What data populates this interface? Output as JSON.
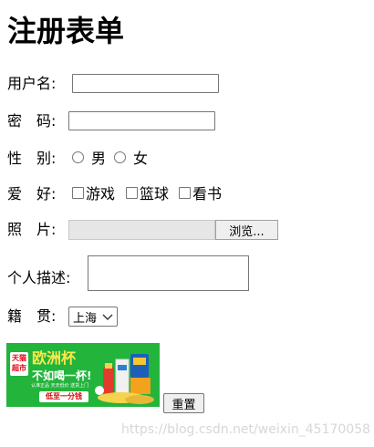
{
  "form": {
    "title": "注册表单",
    "username_label": "用户名:",
    "password_label": "密　码:",
    "gender_label": "性　别:",
    "gender_options": [
      "男",
      "女"
    ],
    "hobby_label": "爱　好:",
    "hobby_options": [
      "游戏",
      "篮球",
      "看书"
    ],
    "photo_label": "照　片:",
    "browse_label": "浏览...",
    "description_label": "个人描述:",
    "origin_label": "籍　贯:",
    "origin_selected": "上海",
    "reset_label": "重置"
  },
  "banner": {
    "badge_top": "天猫",
    "badge_bottom": "超市",
    "headline": "欧洲杯",
    "slogan": "不如喝一杯!",
    "subline": "认准正品 天天低价 送货上门",
    "cta": "低至一分钱",
    "bg_color": "#23b43c"
  },
  "watermark": "https://blog.csdn.net/weixin_45170058"
}
